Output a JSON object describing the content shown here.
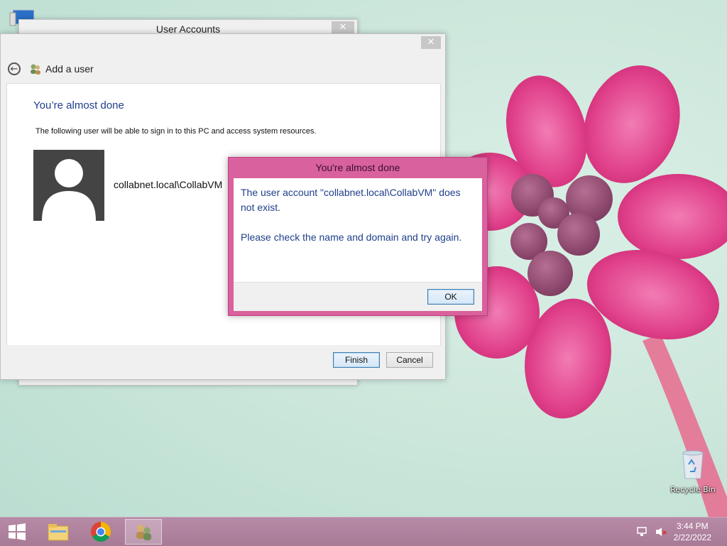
{
  "desktop": {
    "icons": [
      {
        "name": "Recycle Bin",
        "icon": "recycle-bin-icon"
      }
    ]
  },
  "back_window": {
    "title": "User Accounts",
    "close_glyph": "✕"
  },
  "wizard": {
    "close_glyph": "✕",
    "nav_title": "Add a user",
    "heading": "You’re almost done",
    "description": "The following user will be able to sign in to this PC and access system resources.",
    "user_name": "collabnet.local\\CollabVM",
    "finish_label": "Finish",
    "cancel_label": "Cancel"
  },
  "dialog": {
    "title": "You're almost done",
    "message_line1": "The user account \"collabnet.local\\CollabVM\" does not exist.",
    "message_line2": "Please check the name and domain and try again.",
    "ok_label": "OK",
    "accent_color": "#d9619d"
  },
  "taskbar": {
    "items": [
      {
        "name": "start",
        "icon": "windows-logo-icon"
      },
      {
        "name": "file-explorer",
        "icon": "folder-icon"
      },
      {
        "name": "chrome",
        "icon": "chrome-icon"
      },
      {
        "name": "user-accounts",
        "icon": "users-icon",
        "active": true
      }
    ],
    "tray": [
      "network-icon",
      "volume-muted-icon"
    ],
    "time": "3:44 PM",
    "date": "2/22/2022"
  }
}
